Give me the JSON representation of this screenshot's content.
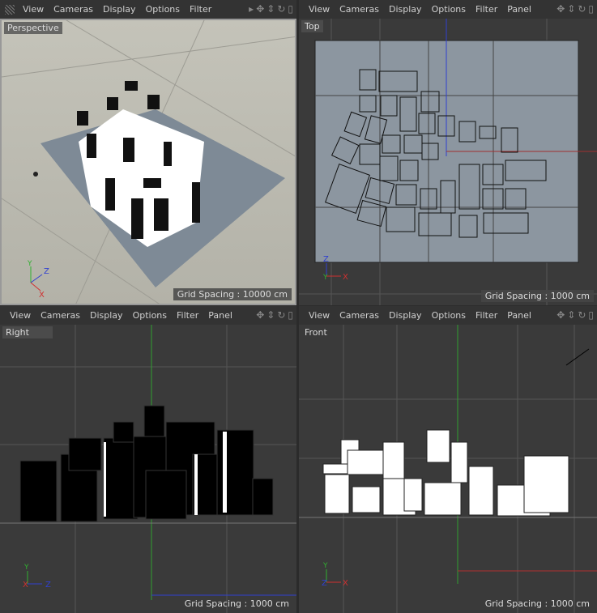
{
  "viewports": [
    {
      "name": "Perspective",
      "menus": [
        "View",
        "Cameras",
        "Display",
        "Options",
        "Filter"
      ],
      "grid": "Grid Spacing : 10000 cm"
    },
    {
      "name": "Top",
      "menus": [
        "View",
        "Cameras",
        "Display",
        "Options",
        "Filter",
        "Panel"
      ],
      "grid": "Grid Spacing : 1000 cm"
    },
    {
      "name": "Right",
      "menus": [
        "View",
        "Cameras",
        "Display",
        "Options",
        "Filter",
        "Panel"
      ],
      "grid": "Grid Spacing : 1000 cm"
    },
    {
      "name": "Front",
      "menus": [
        "View",
        "Cameras",
        "Display",
        "Options",
        "Filter",
        "Panel"
      ],
      "grid": "Grid Spacing : 1000 cm"
    }
  ],
  "axes": {
    "x": "X",
    "y": "Y",
    "z": "Z"
  },
  "colors": {
    "x_axis": "#d03030",
    "y_axis": "#30b030",
    "z_axis": "#3040d0",
    "background": "#3a3a3a",
    "perspective_bg": "#bdbcb2"
  }
}
